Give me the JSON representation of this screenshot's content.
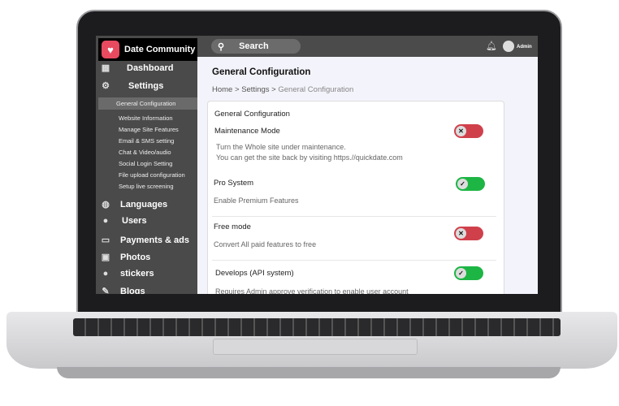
{
  "app": {
    "name": "Date Community",
    "logo_icon": "heart-icon"
  },
  "sidebar": {
    "items": [
      {
        "label": "Dashboard",
        "icon": "grid-icon"
      },
      {
        "label": "Settings",
        "icon": "gear-icon"
      },
      {
        "label": "Languages",
        "icon": "globe-icon"
      },
      {
        "label": "Users",
        "icon": "user-icon"
      },
      {
        "label": "Payments & ads",
        "icon": "wallet-icon"
      },
      {
        "label": "Photos",
        "icon": "image-icon"
      },
      {
        "label": "stickers",
        "icon": "user-icon"
      },
      {
        "label": "Blogs",
        "icon": "edit-icon"
      }
    ],
    "settings_sub": [
      "General Configuration",
      "Website Information",
      "Manage Site Features",
      "Email & SMS setting",
      "Chat & Video/audio",
      "Social Login Setting",
      "File upload configuration",
      "Setup live screening"
    ]
  },
  "topbar": {
    "search_label": "Search",
    "user": "Admin"
  },
  "page": {
    "title": "General Configuration",
    "breadcrumb": {
      "home": "Home",
      "settings": "Settings",
      "current": "General Configuration",
      "sep": ">"
    }
  },
  "card": {
    "heading": "General Configuration",
    "settings": [
      {
        "title": "Maintenance Mode",
        "desc1": "Turn the Whole site under  maintenance.",
        "desc2": "You can get the site back by visiting https.//quickdate.com",
        "enabled": false
      },
      {
        "title": "Pro System",
        "desc1": "Enable Premium Features",
        "enabled": true
      },
      {
        "title": "Free mode",
        "desc1": "Convert All paid features to free",
        "enabled": false
      },
      {
        "title": "Develops (API system)",
        "desc1": "Requires Admin approve verification to enable user account",
        "enabled": true
      }
    ]
  },
  "colors": {
    "toggle_on": "#1db544",
    "toggle_off": "#d0404b",
    "sidebar": "#4a4a4a"
  }
}
